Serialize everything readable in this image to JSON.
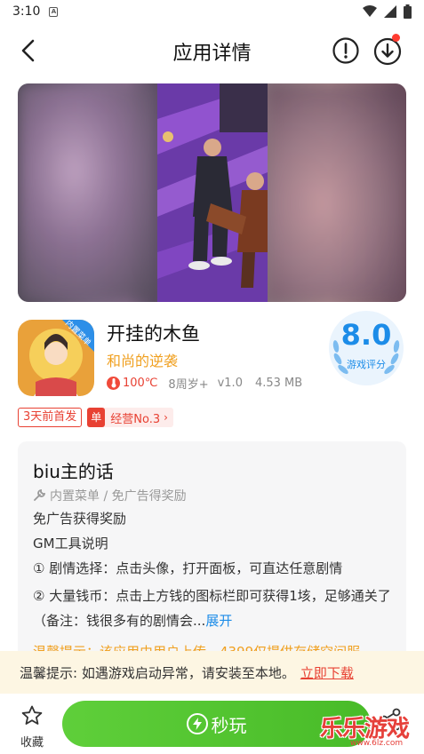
{
  "status_bar": {
    "time": "3:10",
    "sim_label": "A"
  },
  "header": {
    "title": "应用详情"
  },
  "app": {
    "name": "开挂的木鱼",
    "subtitle": "和尚的逆袭",
    "heat": "100℃",
    "age": "8周岁+",
    "version": "v1.0",
    "size": "4.53 MB",
    "icon_badge": "内置菜单"
  },
  "score": {
    "value": "8.0",
    "label": "游戏评分"
  },
  "tags": {
    "first_release": "3天前首发",
    "rank_badge": "单",
    "rank": "经营No.3"
  },
  "description": {
    "title": "biu主的话",
    "features": "内置菜单 / 免广告得奖励",
    "lines": [
      "免广告获得奖励",
      "GM工具说明",
      "① 剧情选择：点击头像，打开面板，可直达任意剧情"
    ],
    "paragraph": "② 大量钱币：点击上方钱的图标栏即可获得1垓，足够通关了（备注：钱很多有的剧情会...",
    "expand": "展开",
    "warm_tip": "温馨提示：该应用由用户上传，4399仅提供存储空间服"
  },
  "notice": {
    "text": "温馨提示: 如遇游戏启动异常，请安装至本地。",
    "link": "立即下载"
  },
  "bottom": {
    "collect_label": "收藏",
    "play_label": "秒玩"
  },
  "watermark": {
    "text": "乐乐游戏",
    "url": "www.6lz.com"
  },
  "colors": {
    "accent_blue": "#1c8ce8",
    "accent_red": "#e84133",
    "accent_orange": "#f0a020",
    "play_green": "#4fc22e"
  }
}
